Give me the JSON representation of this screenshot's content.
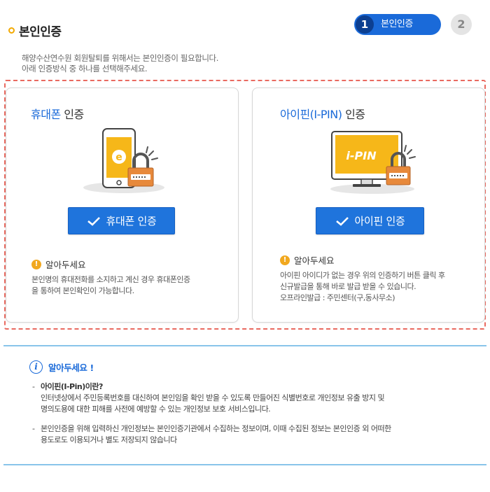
{
  "header": {
    "title": "본인인증",
    "steps": [
      {
        "number": "1",
        "label": "본인인증",
        "active": true
      },
      {
        "number": "2",
        "label": "",
        "active": false
      }
    ]
  },
  "intro": {
    "line1": "해양수산연수원 회원탈퇴를 위해서는 본인인증이 필요합니다.",
    "line2": "아래 인증방식 중 하나를 선택해주세요."
  },
  "phone_card": {
    "title_highlight": "휴대폰",
    "title_rest": " 인증",
    "phone_letter": "e",
    "button_label": "휴대폰 인증",
    "notice_title": "알아두세요",
    "notice_line1": "본인명의 휴대전화를 소지하고 계신 경우 휴대폰인증",
    "notice_line2": "을 통하여 본인확인이 가능합니다."
  },
  "ipin_card": {
    "title_highlight": "아이핀(I-PIN)",
    "title_rest": " 인증",
    "monitor_text": "i-PIN",
    "button_label": "아이핀 인증",
    "notice_title": "알아두세요",
    "notice_line1": "아이핀 아이디가 없는 경우 위의 인증하기 버튼 클릭 후",
    "notice_line2": "신규발급을 통해 바로 발급 받을 수 있습니다.",
    "notice_line3": "오프라인발급 : 주민센터(구,동사무소)"
  },
  "info": {
    "title": "알아두세요 !",
    "item1_question": "아이핀(I-Pin)이란?",
    "item1_line1": "인터넷상에서 주민등록번호를 대신하여 본인임을 확인 받을 수 있도록 만들어진 식별번호로 개인정보 유출 방지 및",
    "item1_line2": "명의도용에 대한 피해를 사전에 예방할 수 있는 개인정보 보호 서비스입니다.",
    "item2_line1": "본인인증을 위해 입력하신 개인정보는 본인인증기관에서 수집하는 정보이며, 이때 수집된 정보는 본인인증 외 어떠한",
    "item2_line2": "용도로도 이용되거나 별도 저장되지 않습니다"
  },
  "colors": {
    "accent": "#1a6ad9",
    "button": "#1f74dc",
    "step_dark": "#0c3f91",
    "warning": "#f1a81f",
    "dashed_border": "#e96a60",
    "info_border": "#89c4ea"
  },
  "icons": {
    "title_bullet": "circle-bullet-icon",
    "check": "check-icon",
    "warning": "exclamation-circle-icon",
    "info": "info-circle-icon",
    "lock": "padlock-icon"
  }
}
